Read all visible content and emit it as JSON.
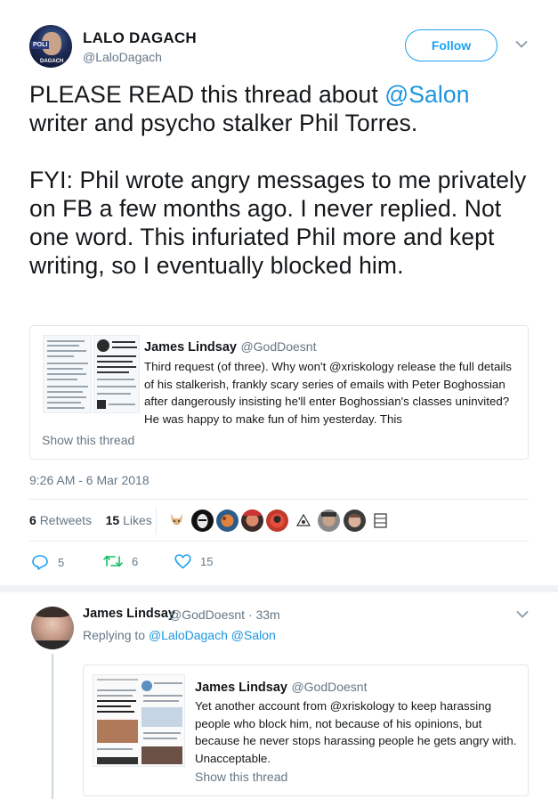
{
  "tweet": {
    "author_name": "LALO DAGACH",
    "author_handle": "@LaloDagach",
    "avatar_text_1": "POLI",
    "avatar_text_2": "DAGACH",
    "follow_label": "Follow",
    "text_line1_pre": "PLEASE READ this thread about ",
    "text_line1_mention": "@Salon",
    "text_line2": "writer and psycho stalker Phil Torres.",
    "text_para2": "FYI: Phil wrote angry messages to me privately on FB a few months ago. I never replied. Not one word. This infuriated Phil more and kept writing, so I eventually blocked him.",
    "timestamp": "9:26 AM - 6 Mar 2018",
    "retweets_count": "6",
    "retweets_label": "Retweets",
    "likes_count": "15",
    "likes_label": "Likes",
    "reply_count": "5",
    "retweet_action_count": "6",
    "like_action_count": "15"
  },
  "quoted_tweet": {
    "name": "James Lindsay",
    "handle": "@GodDoesnt",
    "text": "Third request (of three). Why won't @xriskology release the full details of his stalkerish, frankly scary series of emails with Peter Boghossian after dangerously insisting he'll enter Boghossian's classes uninvited? He was happy to make fun of him yesterday. This",
    "show_thread": "Show this thread"
  },
  "reply": {
    "name": "James Lindsay",
    "handle": "@GodDoesnt",
    "time": "· 33m",
    "replying_prefix": "Replying to",
    "replying_to_1": "@LaloDagach",
    "replying_to_2": "@Salon",
    "quoted": {
      "name": "James Lindsay",
      "handle": "@GodDoesnt",
      "text": "Yet another account from @xriskology to keep harassing people who block him, not because of his opinions, but because he never stops harassing people he gets angry with. Unacceptable.",
      "show_thread": "Show this thread"
    }
  },
  "icons": {
    "caret": "chevron-down-icon",
    "reply": "reply-icon",
    "retweet": "retweet-icon",
    "like": "heart-icon"
  },
  "colors": {
    "accent": "#1da1f2",
    "link": "#1b95e0",
    "secondary_text": "#657786",
    "border": "#e6ecf0"
  }
}
